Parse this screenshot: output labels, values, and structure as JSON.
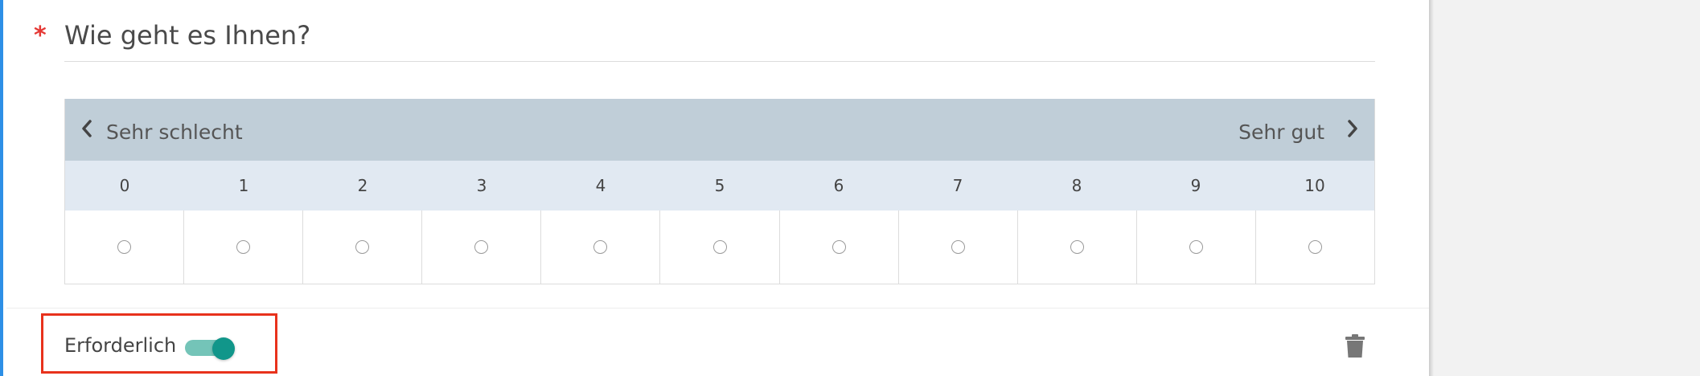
{
  "question": {
    "required_marker": "*",
    "title": "Wie geht es Ihnen?"
  },
  "scale": {
    "min_label": "Sehr schlecht",
    "max_label": "Sehr gut",
    "options": [
      "0",
      "1",
      "2",
      "3",
      "4",
      "5",
      "6",
      "7",
      "8",
      "9",
      "10"
    ]
  },
  "footer": {
    "required_label": "Erforderlich",
    "required_toggle_on": true
  },
  "colors": {
    "accent": "#2d8fe6",
    "required_star": "#e53935",
    "toggle_on": "#11968a",
    "highlight_box": "#e8321c"
  },
  "icons": {
    "prev": "chevron-left-icon",
    "next": "chevron-right-icon",
    "delete": "trash-icon"
  }
}
